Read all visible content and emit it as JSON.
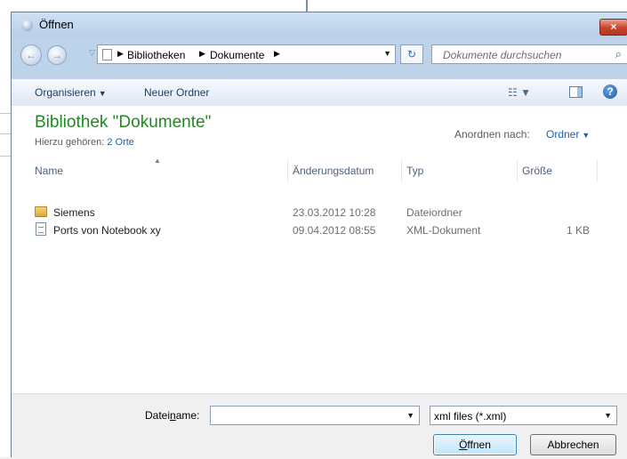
{
  "window": {
    "title": "Öffnen",
    "close_glyph": "×"
  },
  "nav": {
    "back_glyph": "←",
    "forward_glyph": "→",
    "history_glyph": "▽"
  },
  "address": {
    "crumbs": [
      "Bibliotheken",
      "Dokumente"
    ],
    "separator": "▶",
    "dropdown_glyph": "▼"
  },
  "refresh_glyph": "↻",
  "search": {
    "placeholder": "Dokumente durchsuchen",
    "icon": "search-icon",
    "glyph": "⌕"
  },
  "toolbar": {
    "organize_label": "Organisieren",
    "organize_caret": "▼",
    "new_folder_label": "Neuer Ordner",
    "view_glyph": "☷ ▼",
    "help_glyph": "?"
  },
  "library": {
    "title": "Bibliothek \"Dokumente\"",
    "includes_label": "Hierzu gehören:",
    "includes_link": "2 Orte",
    "arrange_label": "Anordnen nach:",
    "arrange_value": "Ordner",
    "arrange_caret": "▼"
  },
  "columns": {
    "name": "Name",
    "date": "Änderungsdatum",
    "type": "Typ",
    "size": "Größe",
    "sort_glyph": "▲"
  },
  "files": [
    {
      "name": "Siemens",
      "date": "23.03.2012 10:28",
      "type": "Dateiordner",
      "size": "",
      "icon": "folder-icon"
    },
    {
      "name": "Ports von Notebook xy",
      "date": "09.04.2012 08:55",
      "type": "XML-Dokument",
      "size": "1 KB",
      "icon": "document-icon"
    }
  ],
  "bottom": {
    "filename_label_pre": "Datei",
    "filename_label_u": "n",
    "filename_label_post": "ame:",
    "filename_value": "",
    "filename_drop": "▼",
    "filter_value": "xml files (*.xml)",
    "filter_drop": "▼",
    "open_pre": "",
    "open_u": "Ö",
    "open_post": "ffnen",
    "cancel_label": "Abbrechen"
  }
}
